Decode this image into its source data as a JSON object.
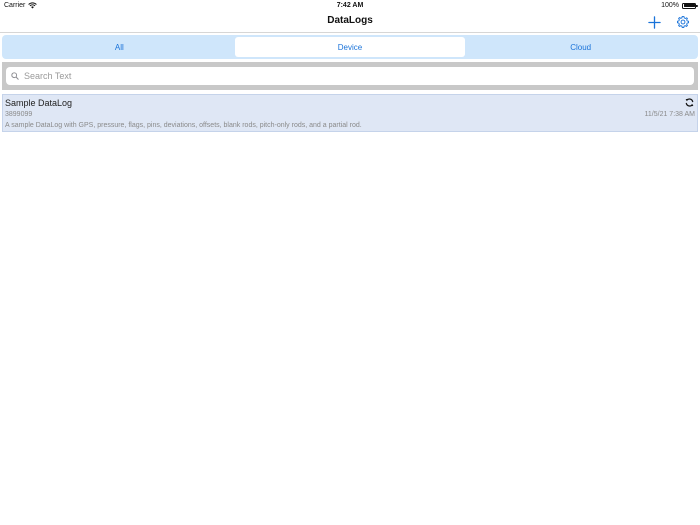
{
  "status_bar": {
    "carrier": "Carrier",
    "time": "7:42 AM",
    "battery": "100%",
    "wifi_icon": "wifi-icon",
    "battery_icon": "battery-icon"
  },
  "nav": {
    "title": "DataLogs",
    "add_icon": "plus-icon",
    "settings_icon": "gear-icon",
    "accent_color": "#1a73d9"
  },
  "segments": {
    "items": [
      "All",
      "Device",
      "Cloud"
    ],
    "selected": "Device"
  },
  "search": {
    "placeholder": "Search Text",
    "value": ""
  },
  "datalogs": [
    {
      "title": "Sample DataLog",
      "id": "3899099",
      "date": "11/5/21 7:38 AM",
      "description": "A sample DataLog with GPS, pressure, flags, pins, deviations, offsets, blank rods, pitch-only rods, and a partial rod.",
      "status_icon": "sync-icon"
    }
  ]
}
